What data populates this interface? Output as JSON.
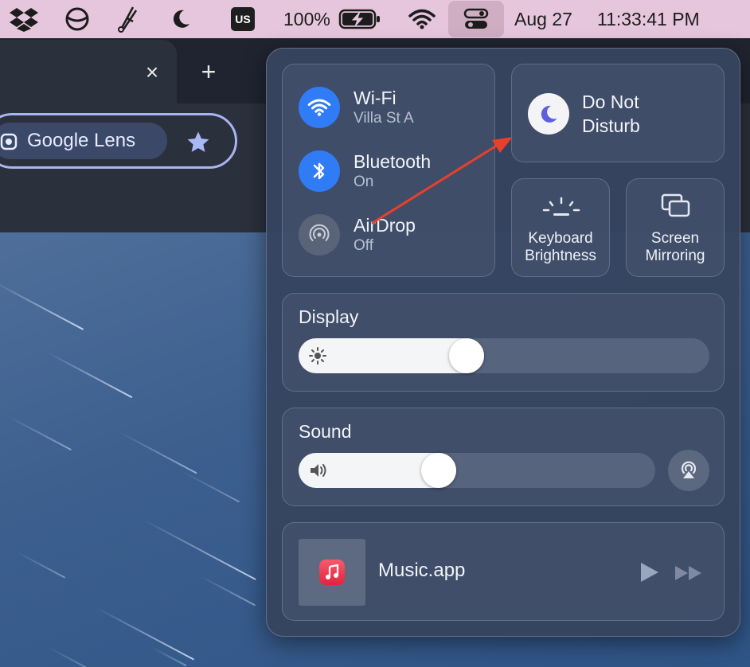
{
  "menubar": {
    "keyboard_layout": "US",
    "battery_percent": "100%",
    "date": "Aug 27",
    "time": "11:33:41 PM",
    "icons": [
      "dropbox-icon",
      "circle-slash-icon",
      "scissors-icon",
      "moon-icon",
      "keyboard-layout-badge",
      "battery-charging-icon",
      "wifi-icon",
      "control-center-icon"
    ]
  },
  "browser": {
    "tab_close": "×",
    "new_tab": "+",
    "lens_label": "Google Lens"
  },
  "control_center": {
    "connectivity": [
      {
        "title": "Wi-Fi",
        "subtitle": "Villa St A",
        "state": "on",
        "icon": "wifi-icon"
      },
      {
        "title": "Bluetooth",
        "subtitle": "On",
        "state": "on",
        "icon": "bluetooth-icon"
      },
      {
        "title": "AirDrop",
        "subtitle": "Off",
        "state": "off",
        "icon": "airdrop-icon"
      }
    ],
    "dnd": {
      "label_line1": "Do Not",
      "label_line2": "Disturb"
    },
    "keyboard_brightness": {
      "line1": "Keyboard",
      "line2": "Brightness"
    },
    "screen_mirroring": {
      "line1": "Screen",
      "line2": "Mirroring"
    },
    "display": {
      "title": "Display",
      "level": 0.4
    },
    "sound": {
      "title": "Sound",
      "level": 0.38
    },
    "now_playing": {
      "app": "Music.app"
    }
  },
  "colors": {
    "accent_blue": "#2f7cf6",
    "annotation_arrow": "#e8402a",
    "menubar": "#e6c6dc"
  }
}
